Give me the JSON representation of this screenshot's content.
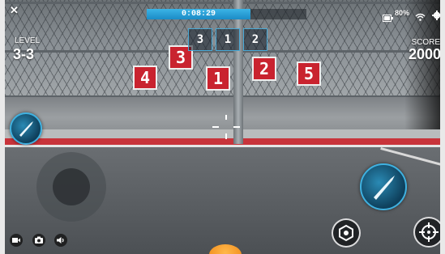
{
  "hud": {
    "close_symbol": "✕",
    "level_label": "LEVEL",
    "level_value": "3-3",
    "score_label": "SCORE",
    "score_value": "2000",
    "timer": "0:08:29",
    "timer_progress": 0.65,
    "battery": "80%",
    "sequence": [
      "3",
      "1",
      "2"
    ]
  },
  "targets": [
    "4",
    "3",
    "1",
    "2",
    "5"
  ],
  "colors": {
    "accent": "#3bb4e6",
    "target_red": "#c9232f",
    "court_red": "#c8343b"
  },
  "icons": {
    "close": "close-icon",
    "settings": "gear-icon",
    "wifi": "wifi-icon",
    "battery": "battery-icon",
    "fire": "bullet-fire-icon",
    "record": "video-camera-icon",
    "photo": "camera-icon",
    "sound": "speaker-icon",
    "hex": "hexagon-target-icon",
    "aim": "crosshair-icon"
  }
}
